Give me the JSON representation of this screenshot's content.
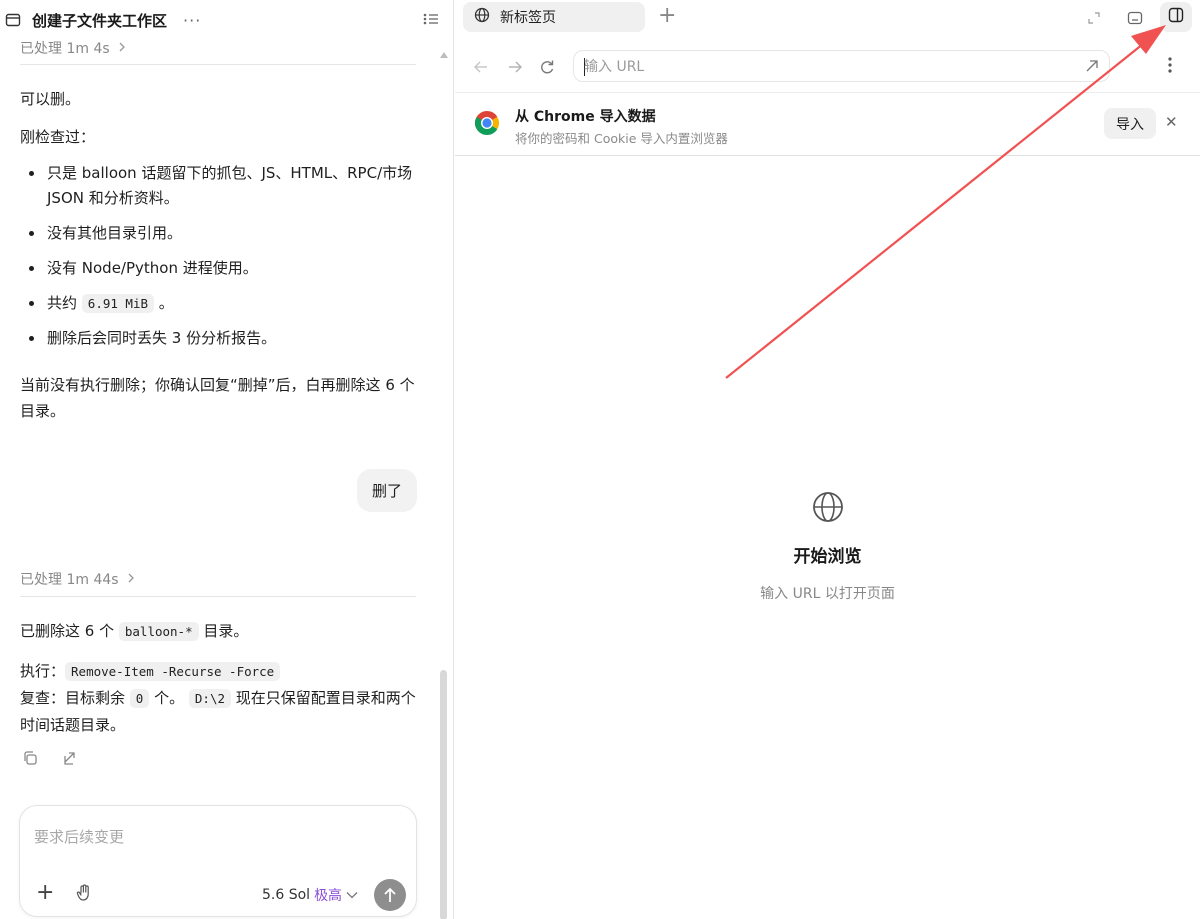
{
  "left": {
    "title": "创建子文件夹工作区",
    "more": "···",
    "processed_top": "已处理 1m 4s",
    "para1": "可以删。",
    "para2": "刚检查过：",
    "bullets": [
      "只是 balloon 话题留下的抓包、JS、HTML、RPC/市场 JSON 和分析资料。",
      "没有其他目录引用。",
      "没有 Node/Python 进程使用。",
      "删除后会同时丢失 3 份分析报告。"
    ],
    "bullet_size_prefix": "共约",
    "bullet_size_code": "6.91 MiB",
    "bullet_size_suffix": "。",
    "para3": "当前没有执行删除；你确认回复“删掉”后，白再删除这 6 个目录。",
    "user_message": "删了",
    "processed_bottom": "已处理 1m 44s",
    "result_prefix": "已删除这 6 个",
    "result_code": "balloon-*",
    "result_suffix": "目录。",
    "exec_label": "执行：",
    "exec_code": "Remove-Item -Recurse -Force",
    "check_label": "复查：目标剩余",
    "check_code1": "0",
    "check_mid": "个。",
    "check_code2": "D:\\2",
    "check_tail": "现在只保留配置目录和两个时间话题目录。",
    "composer_placeholder": "要求后续变更",
    "model_name": "5.6 Sol",
    "model_level": "极高"
  },
  "right": {
    "tab_title": "新标签页",
    "url_placeholder": "输入 URL",
    "import_title": "从 Chrome 导入数据",
    "import_subtitle": "将你的密码和 Cookie 导入内置浏览器",
    "import_button": "导入",
    "start_title": "开始浏览",
    "start_subtitle": "输入 URL 以打开页面"
  },
  "colors": {
    "arrow": "#f05252",
    "accent_purple": "#8a4fd8",
    "send_button": "#8e8e8e"
  }
}
